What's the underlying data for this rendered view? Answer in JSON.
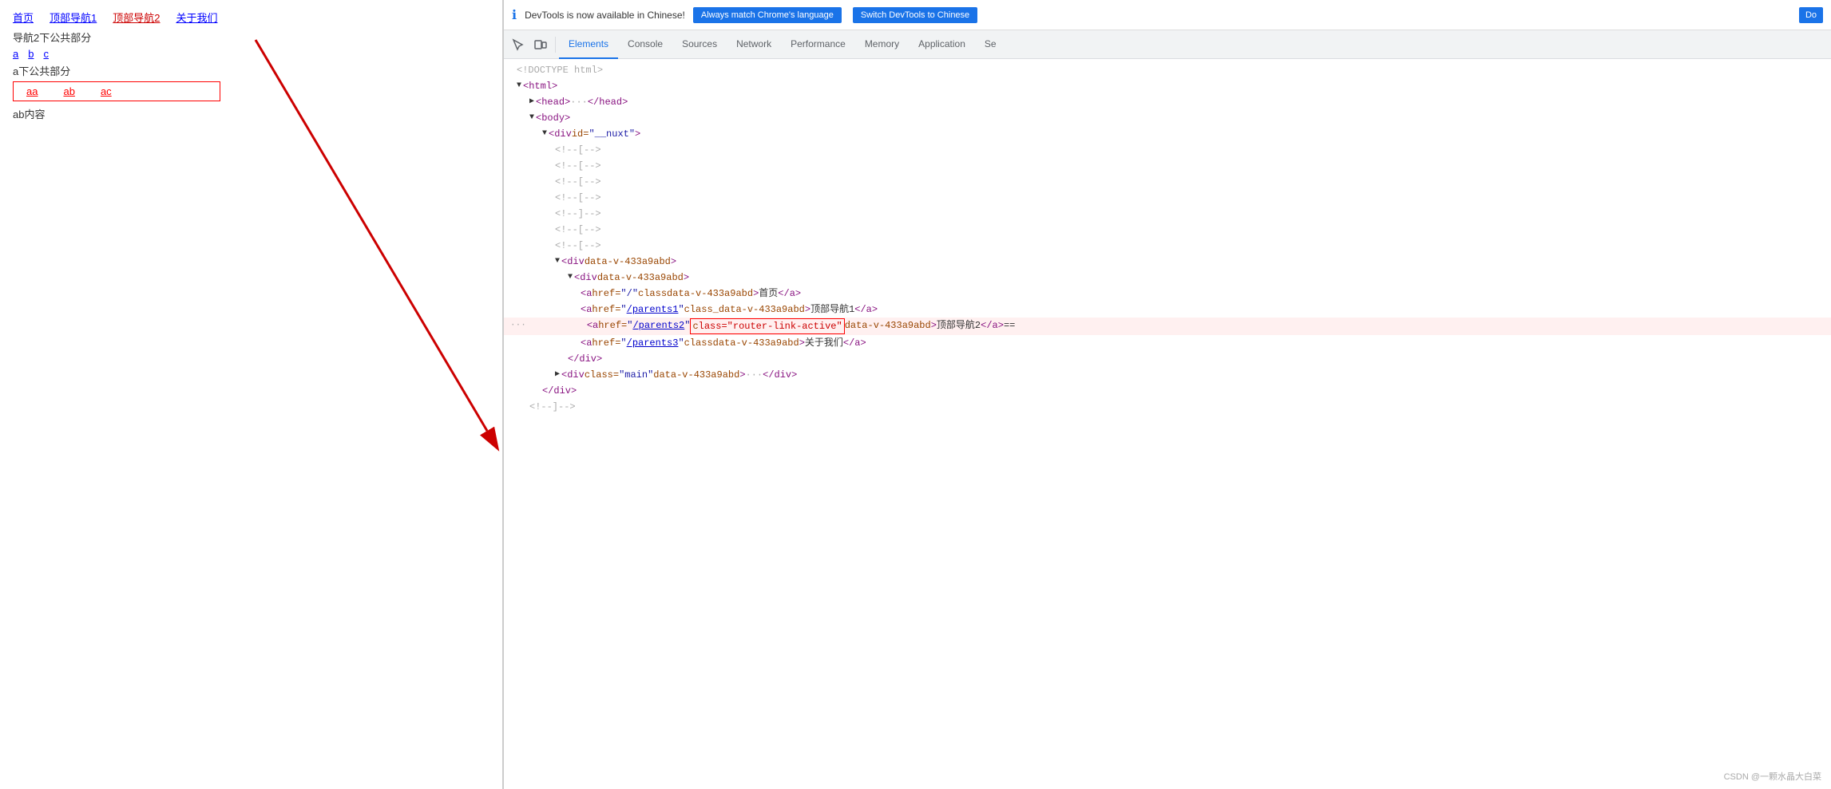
{
  "left": {
    "nav_items": [
      {
        "label": "首页",
        "active": false,
        "href": "/"
      },
      {
        "label": "顶部导航1",
        "active": false,
        "href": "/parents1"
      },
      {
        "label": "顶部导航2",
        "active": true,
        "href": "/parents2"
      },
      {
        "label": "关于我们",
        "active": false,
        "href": "/parents3"
      }
    ],
    "nav_label": "导航2下公共部分",
    "sub_links": [
      {
        "label": "a",
        "href": "/a"
      },
      {
        "label": "b",
        "href": "/b"
      },
      {
        "label": "c",
        "href": "/c"
      }
    ],
    "sub_label": "a下公共部分",
    "sub_box_links": [
      {
        "label": "aa",
        "href": "/aa"
      },
      {
        "label": "ab",
        "href": "/ab"
      },
      {
        "label": "ac",
        "href": "/ac"
      }
    ],
    "page_text": "ab内容"
  },
  "devtools": {
    "notification": {
      "text": "DevTools is now available in Chinese!",
      "btn_match": "Always match Chrome's language",
      "btn_switch": "Switch DevTools to Chinese",
      "btn_do": "Do"
    },
    "tabs": [
      {
        "label": "Elements",
        "active": true
      },
      {
        "label": "Console",
        "active": false
      },
      {
        "label": "Sources",
        "active": false
      },
      {
        "label": "Network",
        "active": false
      },
      {
        "label": "Performance",
        "active": false
      },
      {
        "label": "Memory",
        "active": false
      },
      {
        "label": "Application",
        "active": false
      },
      {
        "label": "Se",
        "active": false
      }
    ],
    "code_lines": [
      {
        "indent": 0,
        "content": "<!DOCTYPE html>",
        "type": "comment"
      },
      {
        "indent": 0,
        "content": "<html>",
        "type": "tag"
      },
      {
        "indent": 1,
        "content": "▶ <head> ··· </head>",
        "type": "collapsed"
      },
      {
        "indent": 1,
        "content": "▼ <body>",
        "type": "tag"
      },
      {
        "indent": 2,
        "content": "▼ <div id=\"__nuxt\">",
        "type": "tag"
      },
      {
        "indent": 3,
        "content": "<!--[-->",
        "type": "comment"
      },
      {
        "indent": 3,
        "content": "<!--[-->",
        "type": "comment"
      },
      {
        "indent": 3,
        "content": "<!--[-->",
        "type": "comment"
      },
      {
        "indent": 3,
        "content": "<!--[-->",
        "type": "comment"
      },
      {
        "indent": 3,
        "content": "<!--]-->",
        "type": "comment"
      },
      {
        "indent": 3,
        "content": "<!--[-->",
        "type": "comment"
      },
      {
        "indent": 3,
        "content": "<!--[-->",
        "type": "comment"
      },
      {
        "indent": 3,
        "content": "▼ <div data-v-433a9abd>",
        "type": "tag"
      },
      {
        "indent": 4,
        "content": "▼ <div data-v-433a9abd>",
        "type": "tag"
      },
      {
        "indent": 5,
        "content": "<a href=\"/\" class data-v-433a9abd>首页</a>",
        "type": "link"
      },
      {
        "indent": 5,
        "content": "<a href=\"/parents1\" class_data-v-433a9abd>顶部导航1 </a>",
        "type": "link"
      },
      {
        "indent": 5,
        "content": "<a href=\"/parents2\" class=\"router-link-active\" data-v-433a9abd>顶部导航2 </a> ==",
        "type": "link_highlighted"
      },
      {
        "indent": 5,
        "content": "<a href=\"/parents3\" class data-v-433a9abd>关于我们</a>",
        "type": "link"
      },
      {
        "indent": 4,
        "content": "</div>",
        "type": "tag"
      },
      {
        "indent": 3,
        "content": "▶ <div class=\"main\" data-v-433a9abd> ··· </div>",
        "type": "collapsed"
      },
      {
        "indent": 2,
        "content": "</div>",
        "type": "tag"
      },
      {
        "indent": 1,
        "content": "<!--]-->",
        "type": "comment"
      }
    ]
  },
  "watermark": "CSDN @一颗水晶大白菜"
}
